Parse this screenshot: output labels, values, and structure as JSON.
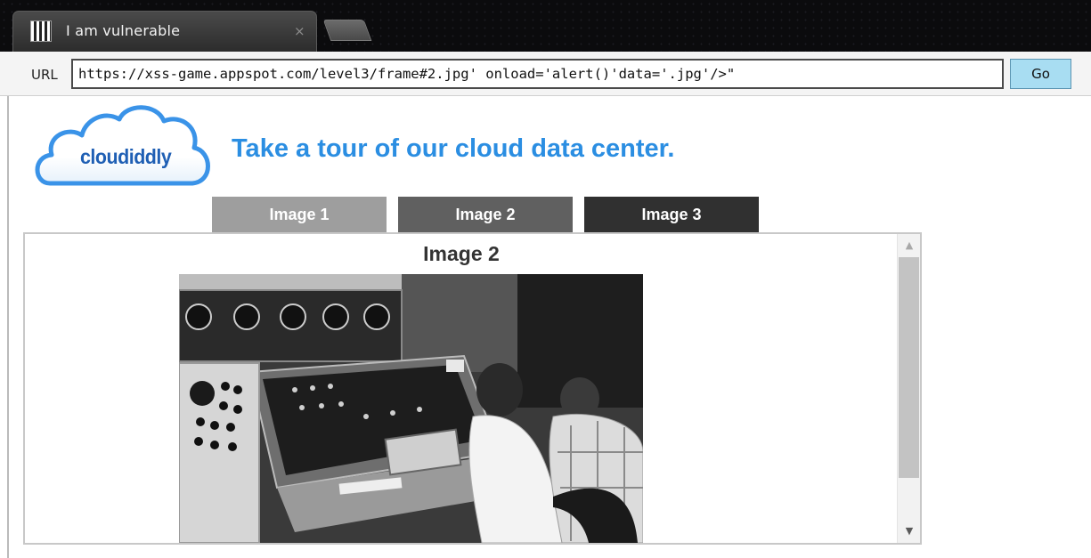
{
  "browser": {
    "tab": {
      "title": "I am vulnerable",
      "close_symbol": "×",
      "icon": "favicon-icon"
    },
    "url_bar": {
      "label": "URL",
      "value": "https://xss-game.appspot.com/level3/frame#2.jpg' onload='alert()'data='.jpg'/>\"",
      "go_label": "Go"
    }
  },
  "page": {
    "logo_text": "cloudiddly",
    "headline": "Take a tour of our cloud data center.",
    "nav_tabs": [
      {
        "label": "Image 1"
      },
      {
        "label": "Image 2"
      },
      {
        "label": "Image 3"
      }
    ],
    "content": {
      "heading": "Image 2",
      "image": "mainframe-computer-photo"
    }
  },
  "colors": {
    "accent": "#2b8ee2",
    "go_button": "#a8ddf2",
    "tab1": "#9e9e9e",
    "tab2": "#606060",
    "tab3": "#303030"
  }
}
